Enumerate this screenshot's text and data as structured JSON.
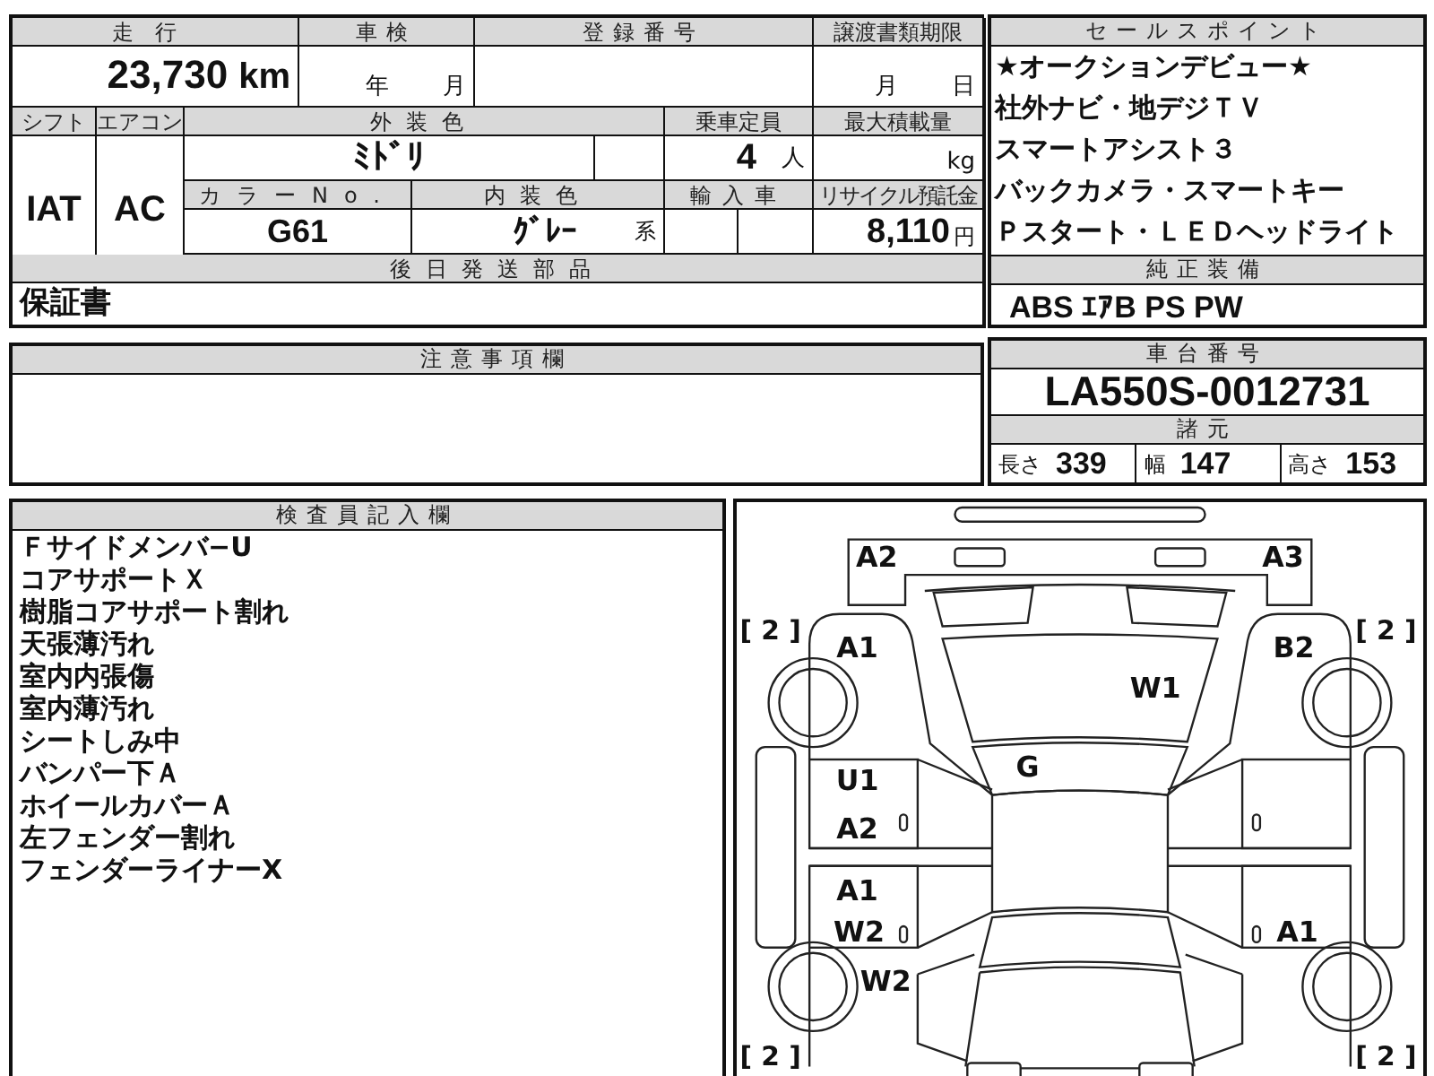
{
  "mileage": {
    "label": "走行",
    "value": "23,730",
    "unit": "km"
  },
  "inspection": {
    "label": "車検",
    "year_unit": "年",
    "month_unit": "月"
  },
  "registration": {
    "label": "登録番号"
  },
  "transfer_deadline": {
    "label": "譲渡書類期限",
    "month_unit": "月",
    "day_unit": "日"
  },
  "shift": {
    "label": "シフト",
    "value": "IAT"
  },
  "aircon": {
    "label": "エアコン",
    "value": "AC"
  },
  "exterior_color": {
    "label": "外装色",
    "value": "ﾐﾄﾞﾘ"
  },
  "capacity": {
    "label": "乗車定員",
    "value": "4",
    "unit": "人"
  },
  "max_load": {
    "label": "最大積載量",
    "unit": "kg"
  },
  "color_no": {
    "label": "カラーNo.",
    "value": "G61"
  },
  "interior_color": {
    "label": "内装色",
    "value": "ｸﾞﾚｰ",
    "suffix": "系"
  },
  "import_car": {
    "label": "輸入車"
  },
  "recycle_fee": {
    "label": "リサイクル預託金",
    "value": "8,110",
    "unit": "円"
  },
  "parts_to_follow": {
    "label": "後日発送部品",
    "value": "保証書"
  },
  "notes": {
    "label": "注意事項欄"
  },
  "sales_points": {
    "label": "セールスポイント",
    "items": [
      "★オークションデビュー★",
      "社外ナビ・地デジＴＶ",
      "スマートアシスト３",
      "バックカメラ・スマートキー",
      "Ｐスタート・ＬＥＤヘッドライト"
    ]
  },
  "standard_equipment": {
    "label": "純正装備",
    "value": "ABS ｴｱB PS PW"
  },
  "chassis": {
    "label": "車台番号",
    "value": "LA550S-0012731"
  },
  "specs": {
    "label": "諸元",
    "items": [
      {
        "label": "長さ",
        "value": "339"
      },
      {
        "label": "幅",
        "value": "147"
      },
      {
        "label": "高さ",
        "value": "153"
      }
    ]
  },
  "inspector_notes": {
    "label": "検査員記入欄",
    "lines": [
      "Ｆサイドメンバ−U",
      "コアサポートＸ",
      "樹脂コアサポート割れ",
      "天張薄汚れ",
      "室内内張傷",
      "室内薄汚れ",
      "シートしみ中",
      "バンパー下Ａ",
      "ホイールカバーＡ",
      "左フェンダー割れ",
      "フェンダーライナーX"
    ]
  },
  "diagram": {
    "codes": [
      "A2",
      "A3",
      "A1",
      "B2",
      "W1",
      "G",
      "U1",
      "A2",
      "A1",
      "W2",
      "A1",
      "W2"
    ],
    "panel_counts": [
      "[ 2 ]",
      "[ 2 ]",
      "[ 2 ]",
      "[ 2 ]"
    ]
  }
}
